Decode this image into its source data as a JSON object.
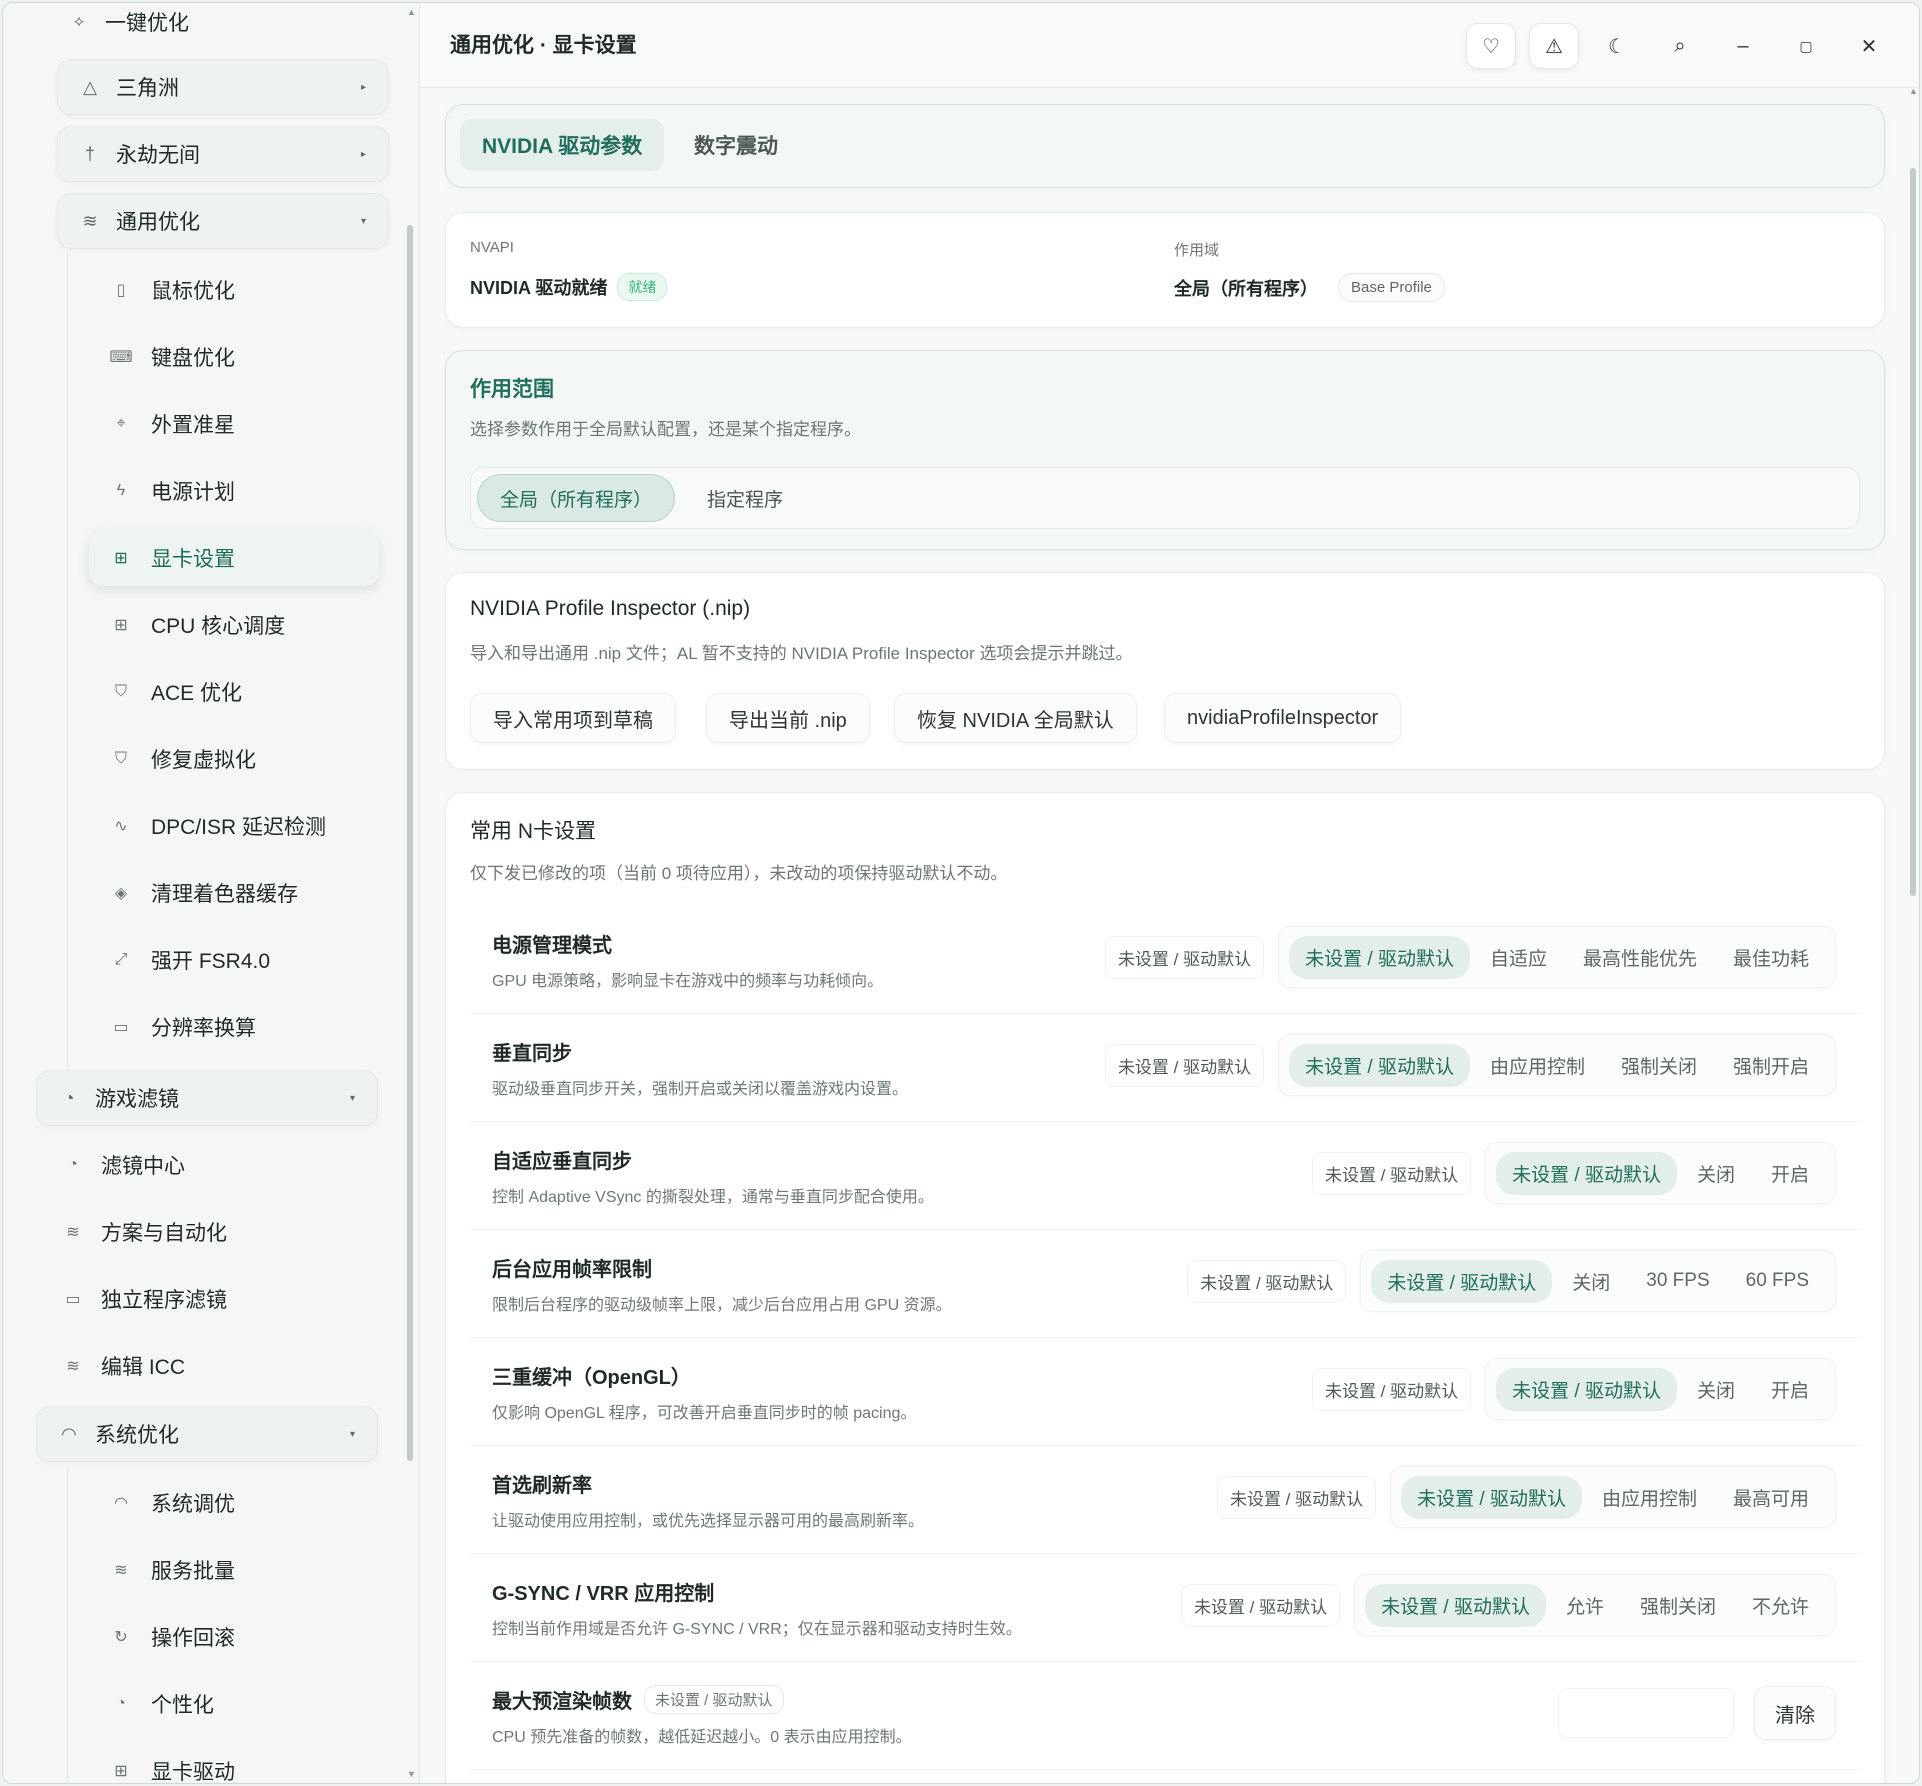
{
  "window_title": "通用优化 · 显卡设置",
  "sidebar": {
    "top_item": "一键优化",
    "groups": [
      {
        "label": "三角洲",
        "icon": "triangle-icon"
      },
      {
        "label": "永劫无间",
        "icon": "dagger-icon"
      },
      {
        "label": "通用优化",
        "icon": "sliders-icon"
      }
    ],
    "general_items": [
      {
        "label": "鼠标优化",
        "icon": "mouse-icon"
      },
      {
        "label": "键盘优化",
        "icon": "keyboard-icon"
      },
      {
        "label": "外置准星",
        "icon": "crosshair-icon"
      },
      {
        "label": "电源计划",
        "icon": "bolt-icon"
      },
      {
        "label": "显卡设置",
        "icon": "chip-icon"
      },
      {
        "label": "CPU 核心调度",
        "icon": "cpu-icon"
      },
      {
        "label": "ACE 优化",
        "icon": "shield-icon"
      },
      {
        "label": "修复虚拟化",
        "icon": "shield-icon"
      },
      {
        "label": "DPC/ISR 延迟检测",
        "icon": "pulse-icon"
      },
      {
        "label": "清理着色器缓存",
        "icon": "layers-icon"
      },
      {
        "label": "强开 FSR4.0",
        "icon": "expand-icon"
      },
      {
        "label": "分辨率换算",
        "icon": "monitor-icon"
      }
    ],
    "filter_group": "游戏滤镜",
    "filter_items": [
      {
        "label": "滤镜中心",
        "icon": "palette-icon"
      },
      {
        "label": "方案与自动化",
        "icon": "sliders-icon"
      },
      {
        "label": "独立程序滤镜",
        "icon": "monitor-icon"
      },
      {
        "label": "编辑 ICC",
        "icon": "sliders-icon"
      }
    ],
    "system_group": "系统优化",
    "system_items": [
      {
        "label": "系统调优",
        "icon": "gauge-icon"
      },
      {
        "label": "服务批量",
        "icon": "sliders-icon"
      },
      {
        "label": "操作回滚",
        "icon": "undo-icon"
      },
      {
        "label": "个性化",
        "icon": "palette-icon"
      },
      {
        "label": "显卡驱动",
        "icon": "chip-icon"
      }
    ]
  },
  "header_buttons": [
    "heart-icon",
    "warning-icon",
    "moon-icon",
    "search-icon",
    "minimize-icon",
    "maximize-icon",
    "close-icon"
  ],
  "tabs": [
    {
      "label": "NVIDIA 驱动参数",
      "active": true
    },
    {
      "label": "数字震动",
      "active": false
    }
  ],
  "status": {
    "nvapi_label": "NVAPI",
    "nvapi_value": "NVIDIA 驱动就绪",
    "nvapi_badge": "就绪",
    "scope_label": "作用域",
    "scope_value": "全局（所有程序）",
    "scope_badge": "Base Profile"
  },
  "scope_card": {
    "title": "作用范围",
    "desc": "选择参数作用于全局默认配置，还是某个指定程序。",
    "options": [
      "全局（所有程序）",
      "指定程序"
    ],
    "selected": "全局（所有程序）"
  },
  "nip_card": {
    "title": "NVIDIA Profile Inspector (.nip)",
    "desc": "导入和导出通用 .nip 文件；AL 暂不支持的 NVIDIA Profile Inspector 选项会提示并跳过。",
    "buttons": [
      "导入常用项到草稿",
      "导出当前 .nip",
      "恢复 NVIDIA 全局默认",
      "nvidiaProfileInspector"
    ]
  },
  "common_card": {
    "title": "常用 N卡设置",
    "desc": "仅下发已修改的项（当前 0 项待应用），未改动的项保持驱动默认不动。",
    "rows": [
      {
        "name": "电源管理模式",
        "desc": "GPU 电源策略，影响显卡在游戏中的频率与功耗倾向。",
        "current": "未设置 / 驱动默认",
        "options": [
          "未设置 / 驱动默认",
          "自适应",
          "最高性能优先",
          "最佳功耗"
        ]
      },
      {
        "name": "垂直同步",
        "desc": "驱动级垂直同步开关，强制开启或关闭以覆盖游戏内设置。",
        "current": "未设置 / 驱动默认",
        "options": [
          "未设置 / 驱动默认",
          "由应用控制",
          "强制关闭",
          "强制开启"
        ]
      },
      {
        "name": "自适应垂直同步",
        "desc": "控制 Adaptive VSync 的撕裂处理，通常与垂直同步配合使用。",
        "current": "未设置 / 驱动默认",
        "options": [
          "未设置 / 驱动默认",
          "关闭",
          "开启"
        ]
      },
      {
        "name": "后台应用帧率限制",
        "desc": "限制后台程序的驱动级帧率上限，减少后台应用占用 GPU 资源。",
        "current": "未设置 / 驱动默认",
        "options": [
          "未设置 / 驱动默认",
          "关闭",
          "30 FPS",
          "60 FPS"
        ]
      },
      {
        "name": "三重缓冲（OpenGL）",
        "desc": "仅影响 OpenGL 程序，可改善开启垂直同步时的帧 pacing。",
        "current": "未设置 / 驱动默认",
        "options": [
          "未设置 / 驱动默认",
          "关闭",
          "开启"
        ]
      },
      {
        "name": "首选刷新率",
        "desc": "让驱动使用应用控制，或优先选择显示器可用的最高刷新率。",
        "current": "未设置 / 驱动默认",
        "options": [
          "未设置 / 驱动默认",
          "由应用控制",
          "最高可用"
        ]
      },
      {
        "name": "G-SYNC / VRR 应用控制",
        "desc": "控制当前作用域是否允许 G-SYNC / VRR；仅在显示器和驱动支持时生效。",
        "current": "未设置 / 驱动默认",
        "options": [
          "未设置 / 驱动默认",
          "允许",
          "强制关闭",
          "不允许"
        ]
      }
    ],
    "prerender": {
      "name": "最大预渲染帧数",
      "badge": "未设置 / 驱动默认",
      "desc": "CPU 预先准备的帧数，越低延迟越小。0 表示由应用控制。",
      "value": "",
      "clear_label": "清除"
    }
  }
}
